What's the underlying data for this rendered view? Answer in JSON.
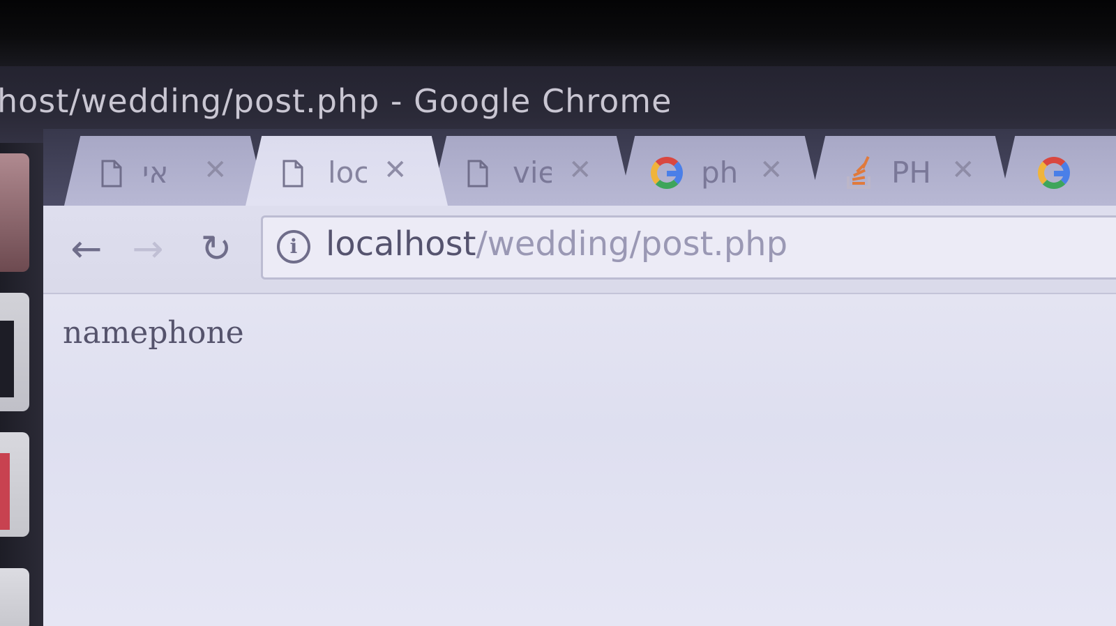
{
  "window": {
    "title": "host/wedding/post.php - Google Chrome"
  },
  "tabs": [
    {
      "label": "אי",
      "icon": "page-icon",
      "active": false
    },
    {
      "label": "loc",
      "icon": "page-icon",
      "active": true
    },
    {
      "label": "vie",
      "icon": "page-icon",
      "active": false
    },
    {
      "label": "ph",
      "icon": "google-icon",
      "active": false
    },
    {
      "label": "PH",
      "icon": "stackoverflow-icon",
      "active": false
    },
    {
      "label": "",
      "icon": "google-icon",
      "active": false
    }
  ],
  "tab_close_glyph": "✕",
  "toolbar": {
    "back_glyph": "←",
    "forward_glyph": "→",
    "reload_glyph": "↻",
    "info_glyph": "i"
  },
  "address_bar": {
    "host": "localhost",
    "path": "/wedding/post.php"
  },
  "page": {
    "body_text": "namephone"
  }
}
